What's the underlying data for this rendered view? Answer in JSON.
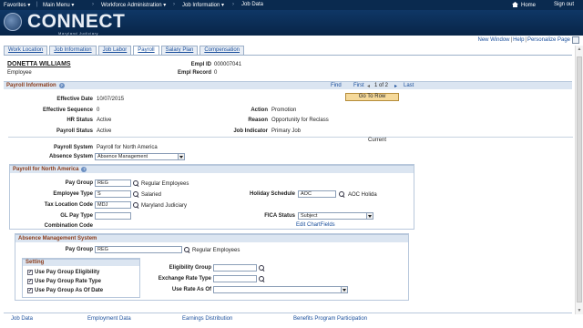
{
  "nav": {
    "favorites": "Favorites",
    "main_menu": "Main Menu",
    "workforce": "Workforce Administration",
    "job_information": "Job Information",
    "job_data": "Job Data",
    "home": "Home",
    "sign_out": "Sign out"
  },
  "brand": {
    "title": "CONNECT",
    "subtitle": "Maryland Judiciary"
  },
  "util": {
    "new_window": "New Window",
    "help": "Help",
    "personalize": "Personalize Page"
  },
  "tabs": [
    "Work Location",
    "Job Information",
    "Job Labor",
    "Payroll",
    "Salary Plan",
    "Compensation"
  ],
  "employee": {
    "name": "DONETTA WILLIAMS",
    "role": "Employee",
    "empl_id_label": "Empl ID",
    "empl_id": "000007041",
    "empl_record_label": "Empl Record",
    "empl_record": "0"
  },
  "payroll_info": {
    "title": "Payroll Information",
    "find": "Find",
    "first": "First",
    "count": "1 of 2",
    "last": "Last",
    "go_to_row": "Go To Row",
    "effective_date_label": "Effective Date",
    "effective_date": "10/07/2015",
    "effective_seq_label": "Effective Sequence",
    "effective_seq": "0",
    "action_label": "Action",
    "action": "Promotion",
    "hr_status_label": "HR Status",
    "hr_status": "Active",
    "reason_label": "Reason",
    "reason": "Opportunity for Reclass",
    "payroll_status_label": "Payroll Status",
    "payroll_status": "Active",
    "job_indicator_label": "Job Indicator",
    "job_indicator": "Primary Job",
    "current": "Current",
    "payroll_system_label": "Payroll System",
    "payroll_system": "Payroll for North America",
    "absence_system_label": "Absence System",
    "absence_system": "Absence Management"
  },
  "pna": {
    "title": "Payroll for North America",
    "pay_group_label": "Pay Group",
    "pay_group": "REG",
    "pay_group_desc": "Regular Employees",
    "employee_type_label": "Employee Type",
    "employee_type": "S",
    "employee_type_desc": "Salaried",
    "holiday_schedule_label": "Holiday Schedule",
    "holiday_schedule": "AOC",
    "holiday_schedule_desc": "AOC Holida",
    "tax_location_label": "Tax Location Code",
    "tax_location": "MDJ",
    "tax_location_desc": "Maryland Judiciary",
    "gl_pay_type_label": "GL Pay Type",
    "gl_pay_type": "",
    "fica_status_label": "FICA Status",
    "fica_status": "Subject",
    "combination_code_label": "Combination Code",
    "edit_chartfields": "Edit ChartFields"
  },
  "ams": {
    "title": "Absence Management System",
    "pay_group_label": "Pay Group",
    "pay_group": "REG",
    "pay_group_desc": "Regular Employees",
    "setting_title": "Setting",
    "chk1": "Use Pay Group Eligibility",
    "chk2": "Use Pay Group Rate Type",
    "chk3": "Use Pay Group As Of Date",
    "chk1_checked": "✔",
    "chk2_checked": "✔",
    "chk3_checked": "✔",
    "eligibility_group_label": "Eligibility Group",
    "eligibility_group": "",
    "exchange_rate_label": "Exchange Rate Type",
    "exchange_rate": "",
    "use_rate_label": "Use Rate As Of",
    "use_rate": ""
  },
  "footer": {
    "job_data": "Job Data",
    "employment_data": "Employment Data",
    "earnings_distribution": "Earnings Distribution",
    "benefits": "Benefits Program Participation"
  },
  "colors": {
    "nav_bg": "#0a2a4f",
    "brand_bg": "#0f3766",
    "section_text": "#8a3b1a",
    "link": "#1a4f9c",
    "button": "#f5d99a"
  }
}
